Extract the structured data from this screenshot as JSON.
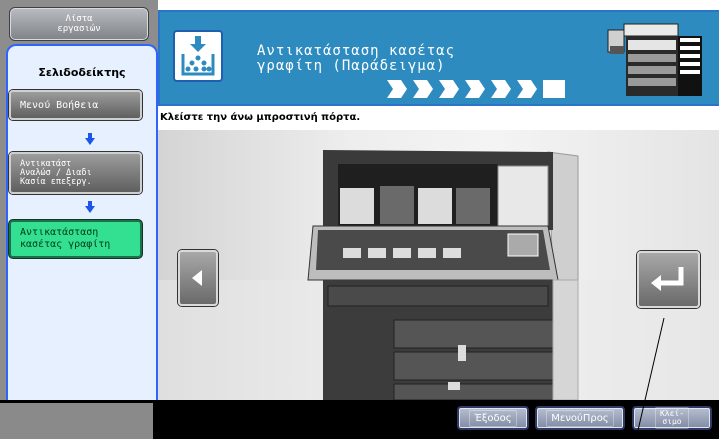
{
  "left_panel": {
    "job_list_label": "Λίστα\nεργασιών",
    "bookmark_title": "Σελιδοδείκτης",
    "steps": [
      {
        "label": "Μενού Βοήθεια"
      },
      {
        "label": "Αντικατάστ\nΑναλώσ / Διαδι\nΚασία επεξεργ."
      },
      {
        "label": "Αντικατάσταση\nκασέτας γραφίτη"
      }
    ]
  },
  "header": {
    "title_line1": "Αντικατάσταση κασέτας",
    "title_line2": "γραφίτη (Παράδειγμα)",
    "progress_total": 7
  },
  "instruction": "Κλείστε την άνω μπροστινή πόρτα.",
  "footer": {
    "exit_label": "Έξοδος",
    "menu_label": "ΜενούΠρος",
    "close_label": "Κλεί-\nσιμο"
  },
  "colors": {
    "header_blue": "#2e8bc0",
    "bookmark_border": "#2f64ff",
    "active_step_green": "#33df90"
  }
}
